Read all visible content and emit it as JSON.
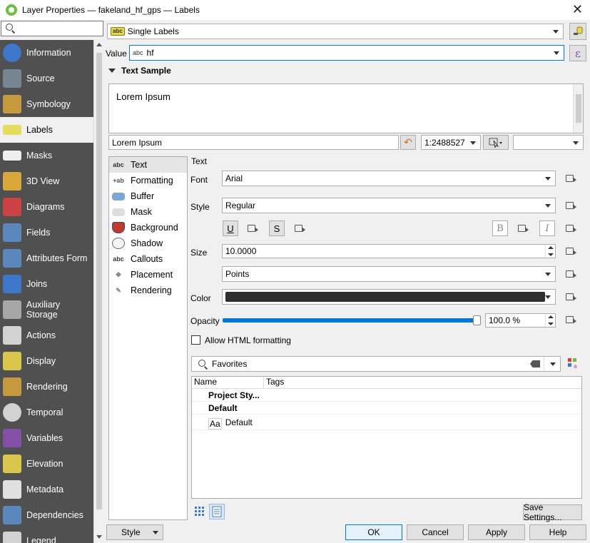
{
  "window": {
    "title": "Layer Properties — fakeland_hf_gps — Labels"
  },
  "sidebar": {
    "search_placeholder": "",
    "items": [
      {
        "label": "Information",
        "icon": "info-icon",
        "color": "#3b7bd6"
      },
      {
        "label": "Source",
        "icon": "source-gear-icon",
        "color": "#7b8b99"
      },
      {
        "label": "Symbology",
        "icon": "symbology-brush-icon",
        "color": "#d2a13a"
      },
      {
        "label": "Labels",
        "icon": "labels-abc-icon",
        "color": "#e6d84a"
      },
      {
        "label": "Masks",
        "icon": "masks-abc-icon",
        "color": "#ffffff"
      },
      {
        "label": "3D View",
        "icon": "cube-icon",
        "color": "#e8b03a"
      },
      {
        "label": "Diagrams",
        "icon": "diagrams-icon",
        "color": "#d94040"
      },
      {
        "label": "Fields",
        "icon": "fields-table-icon",
        "color": "#5b8ec8"
      },
      {
        "label": "Attributes Form",
        "icon": "form-icon",
        "color": "#5b8ec8"
      },
      {
        "label": "Joins",
        "icon": "joins-icon",
        "color": "#3b7bd6"
      },
      {
        "label": "Auxiliary Storage",
        "icon": "database-icon",
        "color": "#b0b0b0"
      },
      {
        "label": "Actions",
        "icon": "actions-gear-icon",
        "color": "#e0e0e0"
      },
      {
        "label": "Display",
        "icon": "display-bubble-icon",
        "color": "#e8d44a"
      },
      {
        "label": "Rendering",
        "icon": "rendering-brush-icon",
        "color": "#d2a13a"
      },
      {
        "label": "Temporal",
        "icon": "clock-icon",
        "color": "#e0e0e0"
      },
      {
        "label": "Variables",
        "icon": "variables-epsilon-icon",
        "color": "#8a4fb0"
      },
      {
        "label": "Elevation",
        "icon": "elevation-icon",
        "color": "#e8d44a"
      },
      {
        "label": "Metadata",
        "icon": "metadata-icon",
        "color": "#f0f0f0"
      },
      {
        "label": "Dependencies",
        "icon": "dependencies-icon",
        "color": "#5b8ec8"
      },
      {
        "label": "Legend",
        "icon": "legend-icon",
        "color": "#e0e0e0"
      }
    ],
    "active_index": 3
  },
  "label_mode": {
    "value": "Single Labels",
    "badge": "abc"
  },
  "value_field": {
    "label": "Value",
    "badge": "abc",
    "value": "hf"
  },
  "text_sample": {
    "heading": "Text Sample",
    "preview_text": "Lorem Ipsum",
    "sample_input": "Lorem Ipsum",
    "scale": "1:2488527"
  },
  "inner_nav": {
    "items": [
      {
        "label": "Text",
        "icon": "text-abc-icon"
      },
      {
        "label": "Formatting",
        "icon": "formatting-icon"
      },
      {
        "label": "Buffer",
        "icon": "buffer-icon"
      },
      {
        "label": "Mask",
        "icon": "mask-icon"
      },
      {
        "label": "Background",
        "icon": "background-shield-icon"
      },
      {
        "label": "Shadow",
        "icon": "shadow-icon"
      },
      {
        "label": "Callouts",
        "icon": "callouts-icon"
      },
      {
        "label": "Placement",
        "icon": "placement-icon"
      },
      {
        "label": "Rendering",
        "icon": "rendering-brush-icon"
      }
    ],
    "active_index": 0
  },
  "text_panel": {
    "heading": "Text",
    "font_label": "Font",
    "font_value": "Arial",
    "style_label": "Style",
    "style_value": "Regular",
    "underline": "U",
    "strikeout": "S",
    "bold": "B",
    "italic": "I",
    "size_label": "Size",
    "size_value": "10.0000",
    "size_unit": "Points",
    "color_label": "Color",
    "color_value": "#2e2e2e",
    "opacity_label": "Opacity",
    "opacity_value": "100.0 %",
    "opacity_fraction": 1.0,
    "html_label": "Allow HTML formatting",
    "html_checked": false
  },
  "style_library": {
    "search_value": "Favorites",
    "col_name": "Name",
    "col_tags": "Tags",
    "rows": [
      {
        "label": "Project Sty...",
        "bold": true,
        "indent": false
      },
      {
        "label": "Default",
        "bold": true,
        "indent": false
      },
      {
        "label": "Default",
        "bold": false,
        "indent": true,
        "sample": "Aa"
      }
    ],
    "save_button": "Save Settings..."
  },
  "footer": {
    "style_button": "Style",
    "ok": "OK",
    "cancel": "Cancel",
    "apply": "Apply",
    "help": "Help"
  }
}
